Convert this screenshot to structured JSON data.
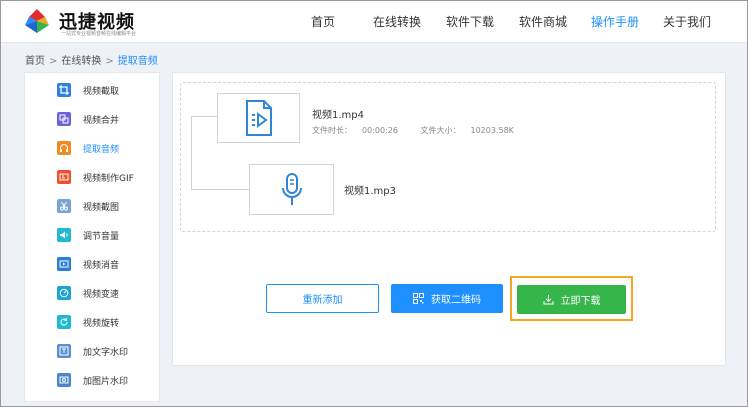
{
  "brand": {
    "name": "迅捷视频",
    "tagline": "一站式专业视频音频在线编辑平台",
    "colors": [
      "#e02d2d",
      "#1e90ff",
      "#36b54a",
      "#f5a623"
    ]
  },
  "nav": {
    "items": [
      {
        "label": "首页",
        "active": false
      },
      {
        "label": "在线转换",
        "active": false
      },
      {
        "label": "软件下载",
        "active": false
      },
      {
        "label": "软件商城",
        "active": false
      },
      {
        "label": "操作手册",
        "active": true
      },
      {
        "label": "关于我们",
        "active": false
      }
    ],
    "active_color": "#1e90ff"
  },
  "breadcrumb": {
    "items": [
      "首页",
      "在线转换",
      "提取音频"
    ],
    "separator": ">"
  },
  "sidebar": {
    "items": [
      {
        "label": "视频截取",
        "icon": "crop-icon",
        "color": "#2f7fe0",
        "active": false
      },
      {
        "label": "视频合并",
        "icon": "merge-icon",
        "color": "#6c63d9",
        "active": false
      },
      {
        "label": "提取音频",
        "icon": "headphones-icon",
        "color": "#f08c22",
        "active": true
      },
      {
        "label": "视频制作GIF",
        "icon": "gif-icon",
        "color": "#e8532c",
        "active": false
      },
      {
        "label": "视频截图",
        "icon": "scissors-icon",
        "color": "#7aa4d6",
        "active": false
      },
      {
        "label": "调节音量",
        "icon": "volume-icon",
        "color": "#23b8d6",
        "active": false
      },
      {
        "label": "视频消音",
        "icon": "mute-icon",
        "color": "#2a7fd9",
        "active": false
      },
      {
        "label": "视频变速",
        "icon": "speed-icon",
        "color": "#1da5cf",
        "active": false
      },
      {
        "label": "视频旋转",
        "icon": "rotate-icon",
        "color": "#20b9d4",
        "active": false
      },
      {
        "label": "加文字水印",
        "icon": "text-watermark-icon",
        "color": "#5a8fd1",
        "active": false
      },
      {
        "label": "加图片水印",
        "icon": "image-watermark-icon",
        "color": "#4a86c9",
        "active": false
      }
    ]
  },
  "source_file": {
    "name": "视频1.mp4",
    "duration_label": "文件时长：",
    "duration": "00:00:26",
    "size_label": "文件大小：",
    "size": "10203.58K",
    "icon": "video-file-icon"
  },
  "output_file": {
    "name": "视频1.mp3",
    "icon": "microphone-icon"
  },
  "actions": {
    "readd": "重新添加",
    "qrcode": "获取二维码",
    "download": "立即下载"
  }
}
